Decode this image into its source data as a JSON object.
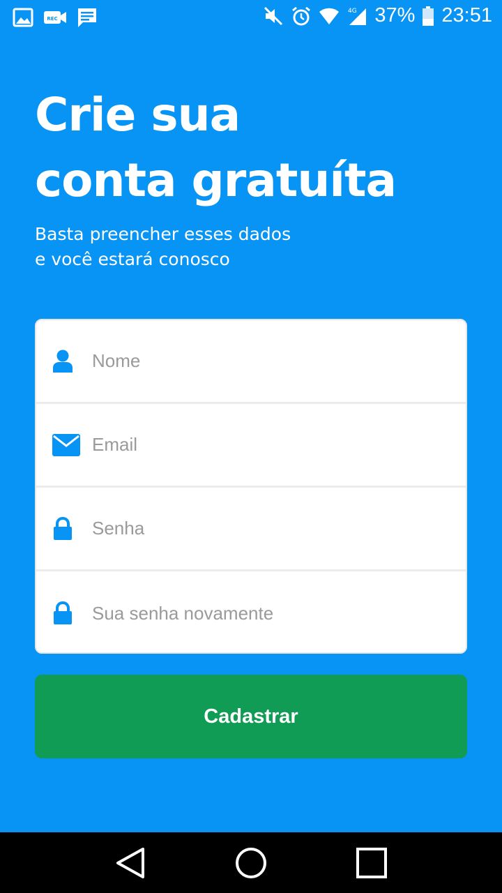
{
  "status_bar": {
    "left_icons": [
      "gallery-icon",
      "rec-video-icon",
      "message-icon"
    ],
    "right_icons": [
      "mute-icon",
      "alarm-icon",
      "wifi-icon",
      "signal-4g-icon",
      "battery-icon"
    ],
    "network_label": "4G",
    "battery_percent": "37%",
    "time": "23:51"
  },
  "header": {
    "title_line1": "Crie sua",
    "title_line2": "conta gratuíta",
    "subtitle_line1": "Basta preencher esses dados",
    "subtitle_line2": "e você estará conosco"
  },
  "form": {
    "fields": [
      {
        "icon": "user-icon",
        "placeholder": "Nome",
        "value": ""
      },
      {
        "icon": "mail-icon",
        "placeholder": "Email",
        "value": ""
      },
      {
        "icon": "lock-icon",
        "placeholder": "Senha",
        "value": ""
      },
      {
        "icon": "lock-icon",
        "placeholder": "Sua senha novamente",
        "value": ""
      }
    ],
    "submit_label": "Cadastrar"
  },
  "nav_bar": {
    "buttons": [
      "back-icon",
      "home-icon",
      "recents-icon"
    ]
  },
  "colors": {
    "background": "#0894F4",
    "accent_icon": "#0894F4",
    "button": "#119C55",
    "placeholder": "#9a9a9a"
  }
}
